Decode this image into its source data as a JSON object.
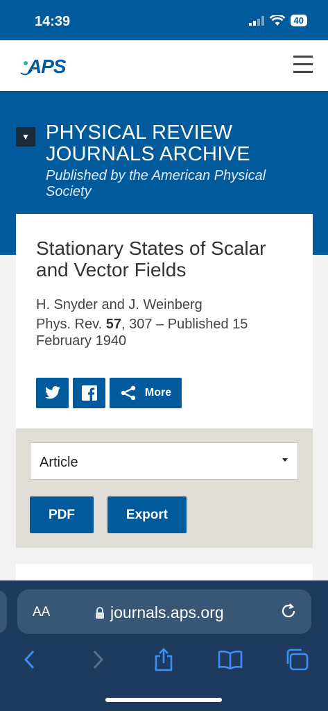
{
  "status": {
    "time": "14:39",
    "battery": "40"
  },
  "nav": {
    "logo_text": "APS",
    "menu_icon": "hamburger-icon"
  },
  "header": {
    "title": "PHYSICAL REVIEW JOURNALS ARCHIVE",
    "subtitle": "Published by the American Physical Society"
  },
  "article": {
    "title": "Stationary States of Scalar and Vector Fields",
    "authors": "H. Snyder and J. Weinberg",
    "journal": "Phys. Rev.",
    "volume": "57",
    "citation_rest": ", 307 – Published 15 February 1940"
  },
  "share": {
    "more_label": "More",
    "twitter_icon": "twitter-icon",
    "facebook_icon": "facebook-icon",
    "share_icon": "share-icon"
  },
  "tools": {
    "select_value": "Article",
    "pdf_label": "PDF",
    "export_label": "Export"
  },
  "browser": {
    "aa": "AA",
    "url": "journals.aps.org"
  },
  "colors": {
    "brand": "#005a9c",
    "panel": "#e0ddd6",
    "browser": "#1e3a5f"
  }
}
